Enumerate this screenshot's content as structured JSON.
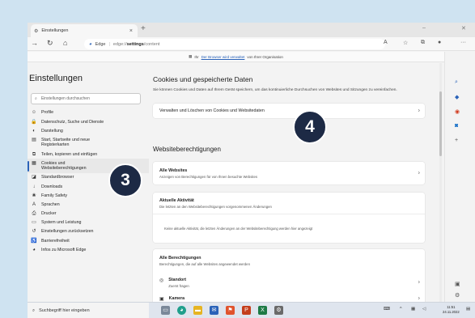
{
  "browser": {
    "tab_title": "Einstellungen",
    "tab_close": "×",
    "new_tab": "+",
    "address": {
      "site_badge": "Edge",
      "url_prefix": "edge://",
      "url_strong": "settings",
      "url_suffix": "/content"
    },
    "info_bar": {
      "prefix": "Ihr",
      "link": "Der Browser wird verwaltet",
      "suffix": "von Ihrer Organisation"
    }
  },
  "sidebar": {
    "title": "Einstellungen",
    "search_placeholder": "Einstellungen durchsuchen",
    "items": [
      {
        "label": "Profile",
        "icon": "profile-icon",
        "glyph": "☺"
      },
      {
        "label": "Datenschutz, Suche und Dienste",
        "icon": "lock-icon",
        "glyph": "🔒"
      },
      {
        "label": "Darstellung",
        "icon": "appearance-icon",
        "glyph": "◐"
      },
      {
        "label": "Start, Startseite und neue Registerkarten",
        "icon": "start-icon",
        "glyph": "▤"
      },
      {
        "label": "Teilen, kopieren und einfügen",
        "icon": "share-icon",
        "glyph": "⧉"
      },
      {
        "label": "Cookies und Websiteberechtigungen",
        "icon": "cookies-icon",
        "glyph": "▦"
      },
      {
        "label": "Standardbrowser",
        "icon": "default-browser-icon",
        "glyph": "◪"
      },
      {
        "label": "Downloads",
        "icon": "download-icon",
        "glyph": "↓"
      },
      {
        "label": "Family Safety",
        "icon": "family-icon",
        "glyph": "❀"
      },
      {
        "label": "Sprachen",
        "icon": "language-icon",
        "glyph": "A"
      },
      {
        "label": "Drucker",
        "icon": "printer-icon",
        "glyph": "⎙"
      },
      {
        "label": "System und Leistung",
        "icon": "system-icon",
        "glyph": "▭"
      },
      {
        "label": "Einstellungen zurücksetzen",
        "icon": "reset-icon",
        "glyph": "↺"
      },
      {
        "label": "Barrierefreiheit",
        "icon": "accessibility-icon",
        "glyph": "♿"
      },
      {
        "label": "Infos zu Microsoft Edge",
        "icon": "edge-icon",
        "glyph": "◕"
      }
    ]
  },
  "main": {
    "title": "Cookies und gespeicherte Daten",
    "description": "Sie können Cookies und Daten auf Ihrem Gerät speichern, um das kontinuierliche Durchsuchen von Websites und Sitzungen zu vereinfachen.",
    "manage_cookies": "Verwalten und Löschen von Cookies und Websitedaten",
    "permissions_title": "Websiteberechtigungen",
    "all_sites": {
      "title": "Alle Websites",
      "subtitle": "Anzeigen von Berechtigungen für von Ihnen besuchte Websites"
    },
    "recent_activity": {
      "title": "Aktuelle Aktivität",
      "subtitle": "Die letzten an den Websiteberechtigungen vorgenommenen Änderungen",
      "empty": "Keine aktuelle Aktivität, die letzten Änderungen an der Websiteberechtigung werden hier angezeigt"
    },
    "all_permissions": {
      "title": "Alle Berechtigungen",
      "subtitle": "Berechtigungen, die auf alle Websites angewendet werden",
      "location_title": "Standort",
      "location_sub": "Zuerst fragen",
      "camera_title": "Kamera"
    }
  },
  "taskbar": {
    "search_placeholder": "Suchbegriff hier eingeben",
    "time": "11:51",
    "date": "24.11.2022"
  },
  "overlays": {
    "step3": "3",
    "step4": "4"
  },
  "colors": {
    "accent": "#2a62b8",
    "bubble": "#1d2a45",
    "background": "#cfe3f1"
  }
}
